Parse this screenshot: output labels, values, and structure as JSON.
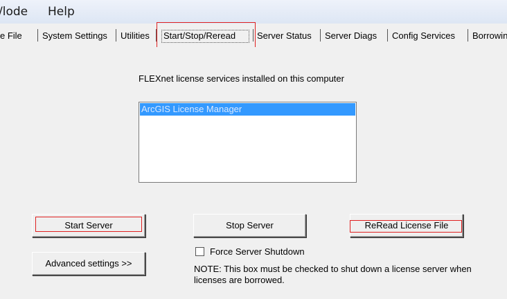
{
  "menubar": {
    "items": [
      "/lode",
      "Help"
    ]
  },
  "tabs": [
    {
      "label": "e File"
    },
    {
      "label": "System Settings"
    },
    {
      "label": "Utilities"
    },
    {
      "label": "Start/Stop/Reread"
    },
    {
      "label": "Server Status"
    },
    {
      "label": "Server Diags"
    },
    {
      "label": "Config Services"
    },
    {
      "label": "Borrowin"
    }
  ],
  "main": {
    "heading": "FLEXnet license services installed on this computer",
    "services": [
      "ArcGIS License Manager"
    ],
    "start_label": "Start Server",
    "stop_label": "Stop Server",
    "reread_label": "ReRead License File",
    "advanced_label": "Advanced settings >>",
    "force_shutdown_label": "Force Server Shutdown",
    "force_shutdown_checked": false,
    "note": "NOTE:  This box must be checked to shut down a license server when licenses are borrowed."
  },
  "colors": {
    "highlight": "#e02020",
    "selection": "#3399ff"
  }
}
